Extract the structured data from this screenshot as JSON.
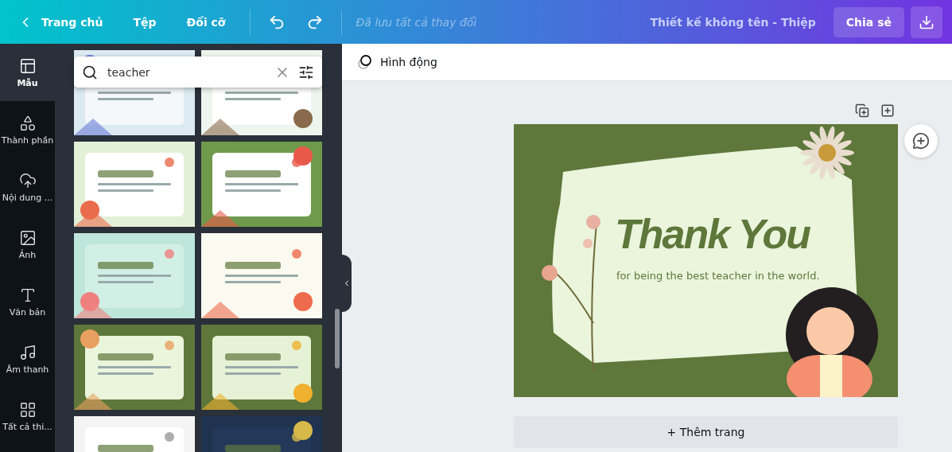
{
  "topbar": {
    "back": "Trang chủ",
    "menu": [
      "Tệp",
      "Đổi cỡ"
    ],
    "status": "Đã lưu tất cả thay đổi",
    "title": "Thiết kế không tên - Thiệp",
    "share": "Chia sẻ"
  },
  "nav": [
    {
      "kind": "templates",
      "label": "Mẫu",
      "selected": true
    },
    {
      "kind": "elements",
      "label": "Thành phần",
      "selected": false
    },
    {
      "kind": "uploads",
      "label": "Nội dung ...",
      "selected": false
    },
    {
      "kind": "photos",
      "label": "Ảnh",
      "selected": false
    },
    {
      "kind": "text",
      "label": "Văn bản",
      "selected": false
    },
    {
      "kind": "audio",
      "label": "Âm thanh",
      "selected": false
    },
    {
      "kind": "apps",
      "label": "Tất cả thi...",
      "selected": false
    }
  ],
  "search": {
    "value": "teacher"
  },
  "toolbar": {
    "animate": "Hình động"
  },
  "card": {
    "title": "Thank You",
    "subtitle": "for being the best teacher in the world."
  },
  "add_page": "+ Thêm trang"
}
